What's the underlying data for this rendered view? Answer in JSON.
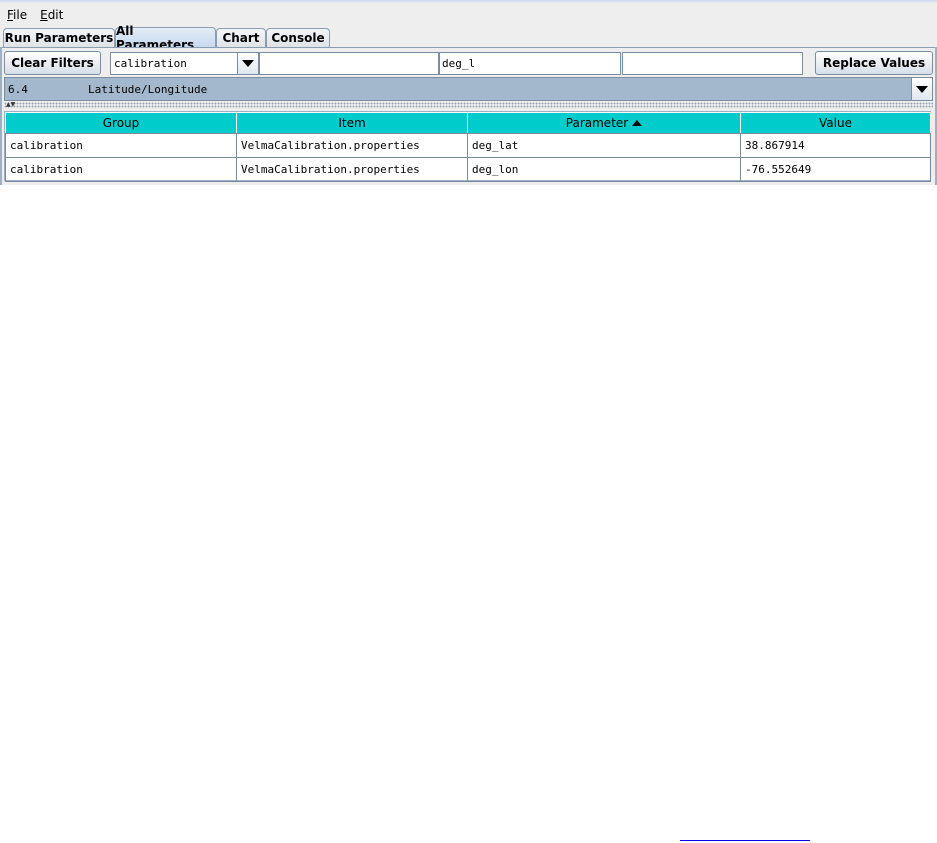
{
  "menu": {
    "file": {
      "mnemonic": "F",
      "rest": "ile"
    },
    "edit": {
      "mnemonic": "E",
      "rest": "dit"
    }
  },
  "tabs": [
    {
      "label": "Run Parameters"
    },
    {
      "label": "All Parameters",
      "active": true
    },
    {
      "label": "Chart"
    },
    {
      "label": "Console"
    }
  ],
  "filters": {
    "clear_label": "Clear Filters",
    "group_value": "calibration",
    "item_value": "",
    "parameter_value": "deg_l",
    "value_value": "",
    "replace_label": "Replace Values"
  },
  "section_selector": {
    "number": "6.4",
    "description": "Latitude/Longitude"
  },
  "table": {
    "columns": [
      "Group",
      "Item",
      "Parameter",
      "Value"
    ],
    "sorted_column": "Parameter",
    "sort_direction": "ascending",
    "rows": [
      [
        "calibration",
        "VelmaCalibration.properties",
        "deg_lat",
        "38.867914"
      ],
      [
        "calibration",
        "VelmaCalibration.properties",
        "deg_lon",
        "-76.552649"
      ]
    ]
  },
  "colors": {
    "header_bg": "#00cccc",
    "selector_bg": "#a3b8cc",
    "panel_bg": "#eeeeee"
  }
}
